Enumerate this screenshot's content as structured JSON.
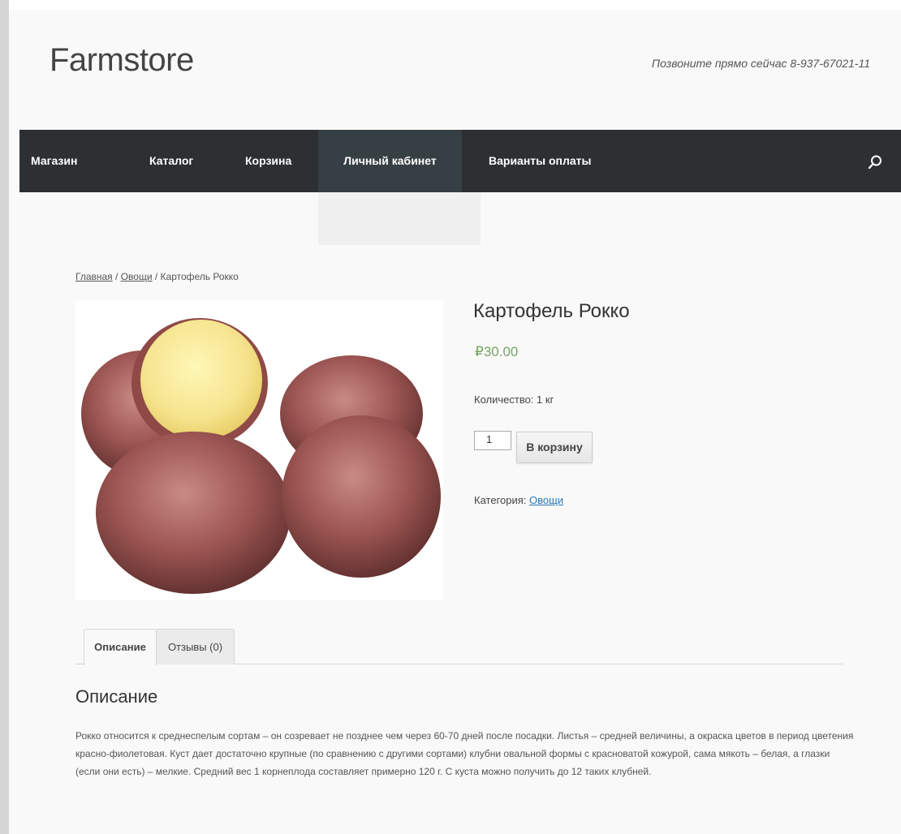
{
  "header": {
    "site_title": "Farmstore",
    "phone": "Позвоните прямо сейчас 8-937-67021-11"
  },
  "nav": {
    "items": [
      {
        "label": "Магазин"
      },
      {
        "label": "Каталог"
      },
      {
        "label": "Корзина"
      },
      {
        "label": "Личный кабинет",
        "active": true
      },
      {
        "label": "Варианты оплаты"
      }
    ],
    "search_icon": "search-icon"
  },
  "breadcrumb": {
    "home": "Главная",
    "sep1": " / ",
    "category": "Овощи",
    "sep2": " / ",
    "current": "Картофель Рокко"
  },
  "product": {
    "title": "Картофель Рокко",
    "price": "₽30.00",
    "quantity_text": "Количество: 1 кг",
    "qty_value": "1",
    "add_to_cart": "В корзину",
    "category_label": "Категория: ",
    "category_link": "Овощи"
  },
  "tabs": [
    {
      "label": "Описание",
      "active": true
    },
    {
      "label": "Отзывы (0)",
      "active": false
    }
  ],
  "description": {
    "heading": "Описание",
    "text": "Рокко относится к среднеспелым сортам – он созревает не позднее чем через 60-70 дней после посадки. Листья – средней величины, а окраска цветов в период цветения красно-фиолетовая. Куст дает достаточно крупные (по сравнению с другими сортами) клубни овальной формы с красноватой кожурой, сама мякоть – белая, а глазки (если они есть) – мелкие. Средний вес 1 корнеплода составляет примерно 120 г. С куста можно получить до 12 таких клубней."
  },
  "colors": {
    "nav_bg": "#2d3032",
    "nav_active": "#363f44",
    "price": "#77a464",
    "link": "#2a7ab5"
  }
}
